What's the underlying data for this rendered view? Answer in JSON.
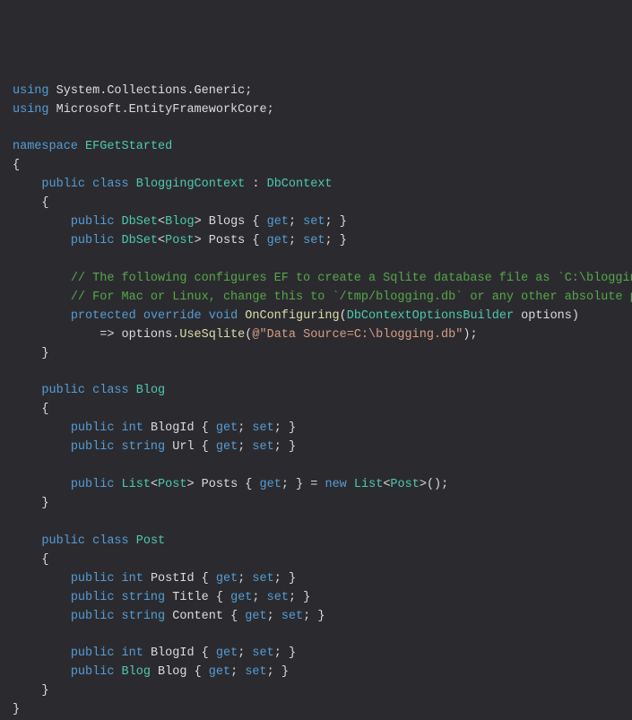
{
  "l1": {
    "kw": "using",
    "ns": "System.Collections.Generic"
  },
  "l2": {
    "kw": "using",
    "ns": "Microsoft.EntityFrameworkCore"
  },
  "l3": {
    "kw": "namespace",
    "name": "EFGetStarted"
  },
  "cls1": {
    "pub": "public",
    "cls": "class",
    "name": "BloggingContext",
    "colon": ":",
    "base": "DbContext"
  },
  "p1": {
    "pub": "public",
    "gen": "DbSet",
    "ga": "Blog",
    "name": "Blogs",
    "get": "get",
    "set": "set"
  },
  "p2": {
    "pub": "public",
    "gen": "DbSet",
    "ga": "Post",
    "name": "Posts",
    "get": "get",
    "set": "set"
  },
  "c1": "// The following configures EF to create a Sqlite database file as `C:\\blogging.db",
  "c2": "// For Mac or Linux, change this to `/tmp/blogging.db` or any other absolute path.",
  "m1": {
    "prot": "protected",
    "ov": "override",
    "void": "void",
    "name": "OnConfiguring",
    "ptype": "DbContextOptionsBuilder",
    "pname": "options"
  },
  "m1body": {
    "arrow": "=>",
    "obj": "options",
    "call": "UseSqlite",
    "at": "@",
    "str": "\"Data Source=C:\\blogging.db\""
  },
  "cls2": {
    "pub": "public",
    "cls": "class",
    "name": "Blog"
  },
  "b1": {
    "pub": "public",
    "t": "int",
    "n": "BlogId",
    "get": "get",
    "set": "set"
  },
  "b2": {
    "pub": "public",
    "t": "string",
    "n": "Url",
    "get": "get",
    "set": "set"
  },
  "b3": {
    "pub": "public",
    "gen": "List",
    "ga": "Post",
    "n": "Posts",
    "get": "get",
    "eq": "=",
    "new": "new",
    "gen2": "List",
    "ga2": "Post"
  },
  "cls3": {
    "pub": "public",
    "cls": "class",
    "name": "Post"
  },
  "q1": {
    "pub": "public",
    "t": "int",
    "n": "PostId",
    "get": "get",
    "set": "set"
  },
  "q2": {
    "pub": "public",
    "t": "string",
    "n": "Title",
    "get": "get",
    "set": "set"
  },
  "q3": {
    "pub": "public",
    "t": "string",
    "n": "Content",
    "get": "get",
    "set": "set"
  },
  "q4": {
    "pub": "public",
    "t": "int",
    "n": "BlogId",
    "get": "get",
    "set": "set"
  },
  "q5": {
    "pub": "public",
    "t": "Blog",
    "n": "Blog",
    "get": "get",
    "set": "set"
  },
  "br": {
    "o": "{",
    "c": "}",
    "sc": ";",
    "lt": "<",
    "gt": ">",
    "lp": "(",
    "rp": ")",
    "dot": ".",
    "eq": "="
  }
}
